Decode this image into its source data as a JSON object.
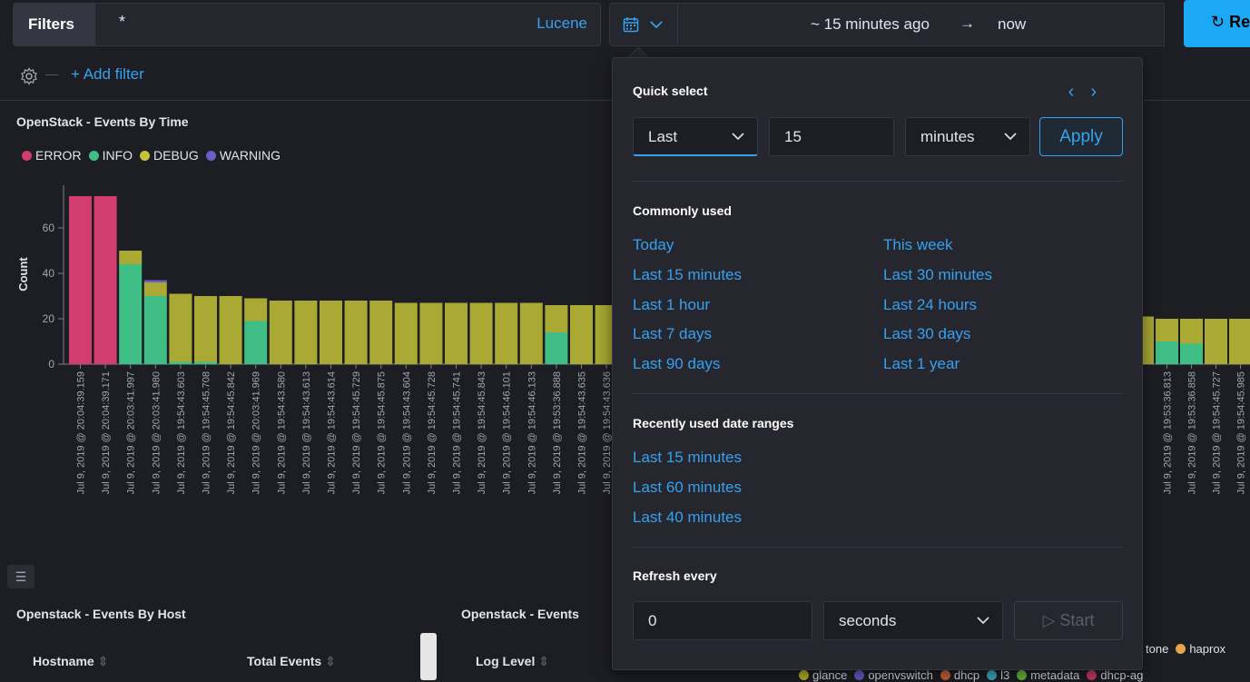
{
  "topbar": {
    "filters_label": "Filters",
    "query_value": "*",
    "query_language": "Lucene",
    "time_from": "~ 15 minutes ago",
    "time_arrow": "→",
    "time_to": "now",
    "refresh_label": "Re"
  },
  "filter_bar": {
    "add_filter_label": "+ Add filter"
  },
  "events_by_time": {
    "title": "OpenStack - Events By Time",
    "legend": [
      {
        "label": "ERROR",
        "color": "#d36086"
      },
      {
        "label": "INFO",
        "color": "#54b399"
      },
      {
        "label": "DEBUG",
        "color": "#b9a888"
      },
      {
        "label": "WARNING",
        "color": "#6092c0"
      }
    ]
  },
  "chart_data": {
    "type": "bar",
    "stacked": true,
    "ylabel": "Count",
    "xlabel": "",
    "ylim": [
      0,
      74
    ],
    "yticks": [
      0,
      20,
      40,
      60
    ],
    "series_colors": {
      "ERROR": "#d03d6e",
      "INFO": "#3fbf86",
      "DEBUG": "#a9a933",
      "WARNING": "#6a5fc8"
    },
    "visible_left": {
      "categories": [
        "Jul 9, 2019 @ 20:04:39.159",
        "Jul 9, 2019 @ 20:04:39.171",
        "Jul 9, 2019 @ 20:03:41.997",
        "Jul 9, 2019 @ 20:03:41.980",
        "Jul 9, 2019 @ 19:54:43.603",
        "Jul 9, 2019 @ 19:54:45.708",
        "Jul 9, 2019 @ 19:54:45.842",
        "Jul 9, 2019 @ 20:03:41.969",
        "Jul 9, 2019 @ 19:54:43.580",
        "Jul 9, 2019 @ 19:54:43.613",
        "Jul 9, 2019 @ 19:54:43.614",
        "Jul 9, 2019 @ 19:54:45.729",
        "Jul 9, 2019 @ 19:54:45.875",
        "Jul 9, 2019 @ 19:54:43.604",
        "Jul 9, 2019 @ 19:54:45.728",
        "Jul 9, 2019 @ 19:54:45.741",
        "Jul 9, 2019 @ 19:54:45.843",
        "Jul 9, 2019 @ 19:54:46.101",
        "Jul 9, 2019 @ 19:54:46.133",
        "Jul 9, 2019 @ 19:53:36.888",
        "Jul 9, 2019 @ 19:54:43.635",
        "Jul 9, 2019 @ 19:54:43.636"
      ],
      "series": [
        {
          "name": "ERROR",
          "values": [
            74,
            74,
            0,
            0,
            0,
            0,
            0,
            0,
            0,
            0,
            0,
            0,
            0,
            0,
            0,
            0,
            0,
            0,
            0,
            0,
            0,
            0
          ]
        },
        {
          "name": "INFO",
          "values": [
            0,
            0,
            44,
            30,
            1,
            1,
            0,
            19,
            0,
            0,
            0,
            0,
            0,
            0,
            0,
            0,
            0,
            0,
            0,
            14,
            0,
            0
          ]
        },
        {
          "name": "DEBUG",
          "values": [
            0,
            0,
            6,
            6,
            30,
            29,
            30,
            10,
            28,
            28,
            28,
            28,
            28,
            27,
            27,
            27,
            27,
            27,
            27,
            12,
            26,
            26
          ]
        },
        {
          "name": "WARNING",
          "values": [
            0,
            0,
            0,
            1,
            0,
            0,
            0,
            0,
            0,
            0,
            0,
            0,
            0,
            0,
            0,
            0,
            0,
            0,
            0,
            0,
            0,
            0
          ]
        }
      ]
    },
    "visible_right": {
      "categories": [
        "",
        "Jul 9, 2019 @ 19:53:36.813",
        "Jul 9, 2019 @ 19:53:36.858",
        "Jul 9, 2019 @ 19:54:45.727",
        "Jul 9, 2019 @ 19:54:45.985"
      ],
      "series": [
        {
          "name": "ERROR",
          "values": [
            0,
            0,
            0,
            0,
            0
          ]
        },
        {
          "name": "INFO",
          "values": [
            0,
            10,
            9,
            0,
            0
          ]
        },
        {
          "name": "DEBUG",
          "values": [
            21,
            10,
            11,
            20,
            20
          ]
        },
        {
          "name": "WARNING",
          "values": [
            0,
            0,
            0,
            0,
            0
          ]
        }
      ]
    }
  },
  "events_by_host": {
    "title": "Openstack - Events By Host",
    "columns": [
      "Hostname",
      "Total Events"
    ]
  },
  "events_panel": {
    "title": "Openstack - Events",
    "columns": [
      "Log Level"
    ]
  },
  "bottom_legend": {
    "row1": [
      {
        "label": "tone",
        "color": null
      },
      {
        "label": "haprox",
        "color": "#e7a44b"
      }
    ],
    "row2": [
      {
        "label": "glance",
        "color": "#b9b92c"
      },
      {
        "label": "openvswitch",
        "color": "#6a5fc8"
      },
      {
        "label": "dhcp",
        "color": "#d0643c"
      },
      {
        "label": "l3",
        "color": "#3ab0c9"
      },
      {
        "label": "metadata",
        "color": "#6cbf44"
      },
      {
        "label": "dhcp-ag",
        "color": "#d03d6e"
      }
    ]
  },
  "popover": {
    "quick_select": {
      "title": "Quick select",
      "prev": "‹",
      "next": "›",
      "direction": "Last",
      "value": "15",
      "unit": "minutes",
      "apply_label": "Apply"
    },
    "commonly_used": {
      "title": "Commonly used",
      "left": [
        "Today",
        "Last 15 minutes",
        "Last 1 hour",
        "Last 7 days",
        "Last 90 days"
      ],
      "right": [
        "This week",
        "Last 30 minutes",
        "Last 24 hours",
        "Last 30 days",
        "Last 1 year"
      ]
    },
    "recently_used": {
      "title": "Recently used date ranges",
      "items": [
        "Last 15 minutes",
        "Last 60 minutes",
        "Last 40 minutes"
      ]
    },
    "refresh": {
      "title": "Refresh every",
      "value": "0",
      "unit": "seconds",
      "start_label": "Start"
    }
  }
}
